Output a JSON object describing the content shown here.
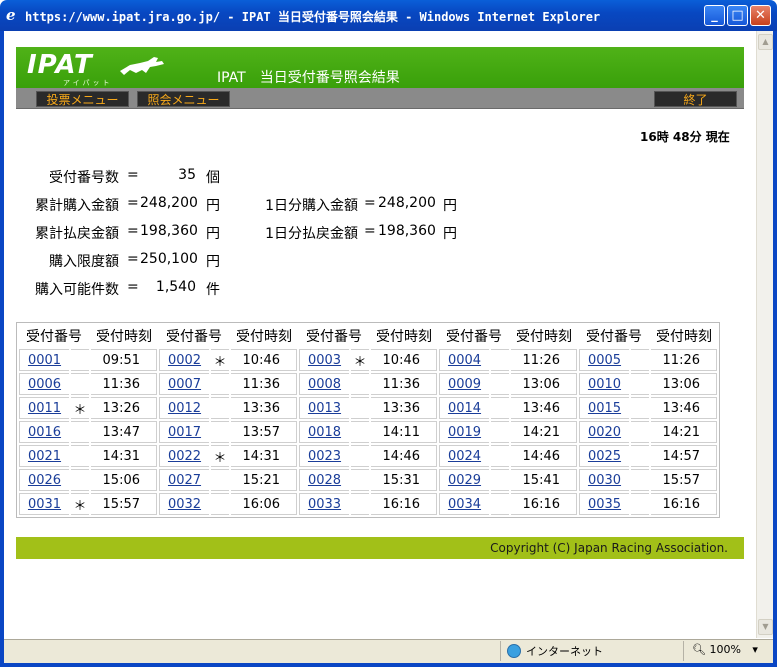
{
  "window": {
    "title": "https://www.ipat.jra.go.jp/ - IPAT 当日受付番号照会結果 - Windows Internet Explorer",
    "icon": "ie-icon",
    "min": "_",
    "max": "□",
    "close": "✕"
  },
  "header": {
    "logo": "IPAT",
    "logo_sub": "アイパット",
    "heading": "IPAT　当日受付番号照会結果"
  },
  "menu": {
    "vote_menu": "投票メニュー",
    "inquiry_menu": "照会メニュー",
    "exit": "終了"
  },
  "now": "16時 48分 現在",
  "summary": {
    "count_label": "受付番号数",
    "count_value": "35",
    "count_unit": "個",
    "total_purchase_label": "累計購入金額",
    "total_purchase_value": "248,200",
    "total_purchase_unit": "円",
    "day_purchase_label": "1日分購入金額",
    "day_purchase_value": "248,200",
    "day_purchase_unit": "円",
    "total_refund_label": "累計払戻金額",
    "total_refund_value": "198,360",
    "total_refund_unit": "円",
    "day_refund_label": "1日分払戻金額",
    "day_refund_value": "198,360",
    "day_refund_unit": "円",
    "limit_label": "購入限度額",
    "limit_value": "250,100",
    "limit_unit": "円",
    "possible_label": "購入可能件数",
    "possible_value": "1,540",
    "possible_unit": "件",
    "eq": "="
  },
  "table": {
    "col_number": "受付番号",
    "col_time": "受付時刻",
    "rows": [
      [
        {
          "n": "0001",
          "m": "",
          "t": "09:51"
        },
        {
          "n": "0002",
          "m": "＊",
          "t": "10:46"
        },
        {
          "n": "0003",
          "m": "＊",
          "t": "10:46"
        },
        {
          "n": "0004",
          "m": "",
          "t": "11:26"
        },
        {
          "n": "0005",
          "m": "",
          "t": "11:26"
        }
      ],
      [
        {
          "n": "0006",
          "m": "",
          "t": "11:36"
        },
        {
          "n": "0007",
          "m": "",
          "t": "11:36"
        },
        {
          "n": "0008",
          "m": "",
          "t": "11:36"
        },
        {
          "n": "0009",
          "m": "",
          "t": "13:06"
        },
        {
          "n": "0010",
          "m": "",
          "t": "13:06"
        }
      ],
      [
        {
          "n": "0011",
          "m": "＊",
          "t": "13:26"
        },
        {
          "n": "0012",
          "m": "",
          "t": "13:36"
        },
        {
          "n": "0013",
          "m": "",
          "t": "13:36"
        },
        {
          "n": "0014",
          "m": "",
          "t": "13:46"
        },
        {
          "n": "0015",
          "m": "",
          "t": "13:46"
        }
      ],
      [
        {
          "n": "0016",
          "m": "",
          "t": "13:47"
        },
        {
          "n": "0017",
          "m": "",
          "t": "13:57"
        },
        {
          "n": "0018",
          "m": "",
          "t": "14:11"
        },
        {
          "n": "0019",
          "m": "",
          "t": "14:21"
        },
        {
          "n": "0020",
          "m": "",
          "t": "14:21"
        }
      ],
      [
        {
          "n": "0021",
          "m": "",
          "t": "14:31"
        },
        {
          "n": "0022",
          "m": "＊",
          "t": "14:31"
        },
        {
          "n": "0023",
          "m": "",
          "t": "14:46"
        },
        {
          "n": "0024",
          "m": "",
          "t": "14:46"
        },
        {
          "n": "0025",
          "m": "",
          "t": "14:57"
        }
      ],
      [
        {
          "n": "0026",
          "m": "",
          "t": "15:06"
        },
        {
          "n": "0027",
          "m": "",
          "t": "15:21"
        },
        {
          "n": "0028",
          "m": "",
          "t": "15:31"
        },
        {
          "n": "0029",
          "m": "",
          "t": "15:41"
        },
        {
          "n": "0030",
          "m": "",
          "t": "15:57"
        }
      ],
      [
        {
          "n": "0031",
          "m": "＊",
          "t": "15:57"
        },
        {
          "n": "0032",
          "m": "",
          "t": "16:06"
        },
        {
          "n": "0033",
          "m": "",
          "t": "16:16"
        },
        {
          "n": "0034",
          "m": "",
          "t": "16:16"
        },
        {
          "n": "0035",
          "m": "",
          "t": "16:16"
        }
      ]
    ]
  },
  "footer": {
    "copyright": "Copyright (C) Japan Racing Association."
  },
  "statusbar": {
    "zone": "インターネット",
    "zoom": "100%",
    "zoom_arrow": "▾"
  },
  "colors": {
    "header_green": "#3fa30e",
    "menu_orange": "#f6a81a",
    "footer_lime": "#a2c018",
    "link": "#1a3d99"
  }
}
